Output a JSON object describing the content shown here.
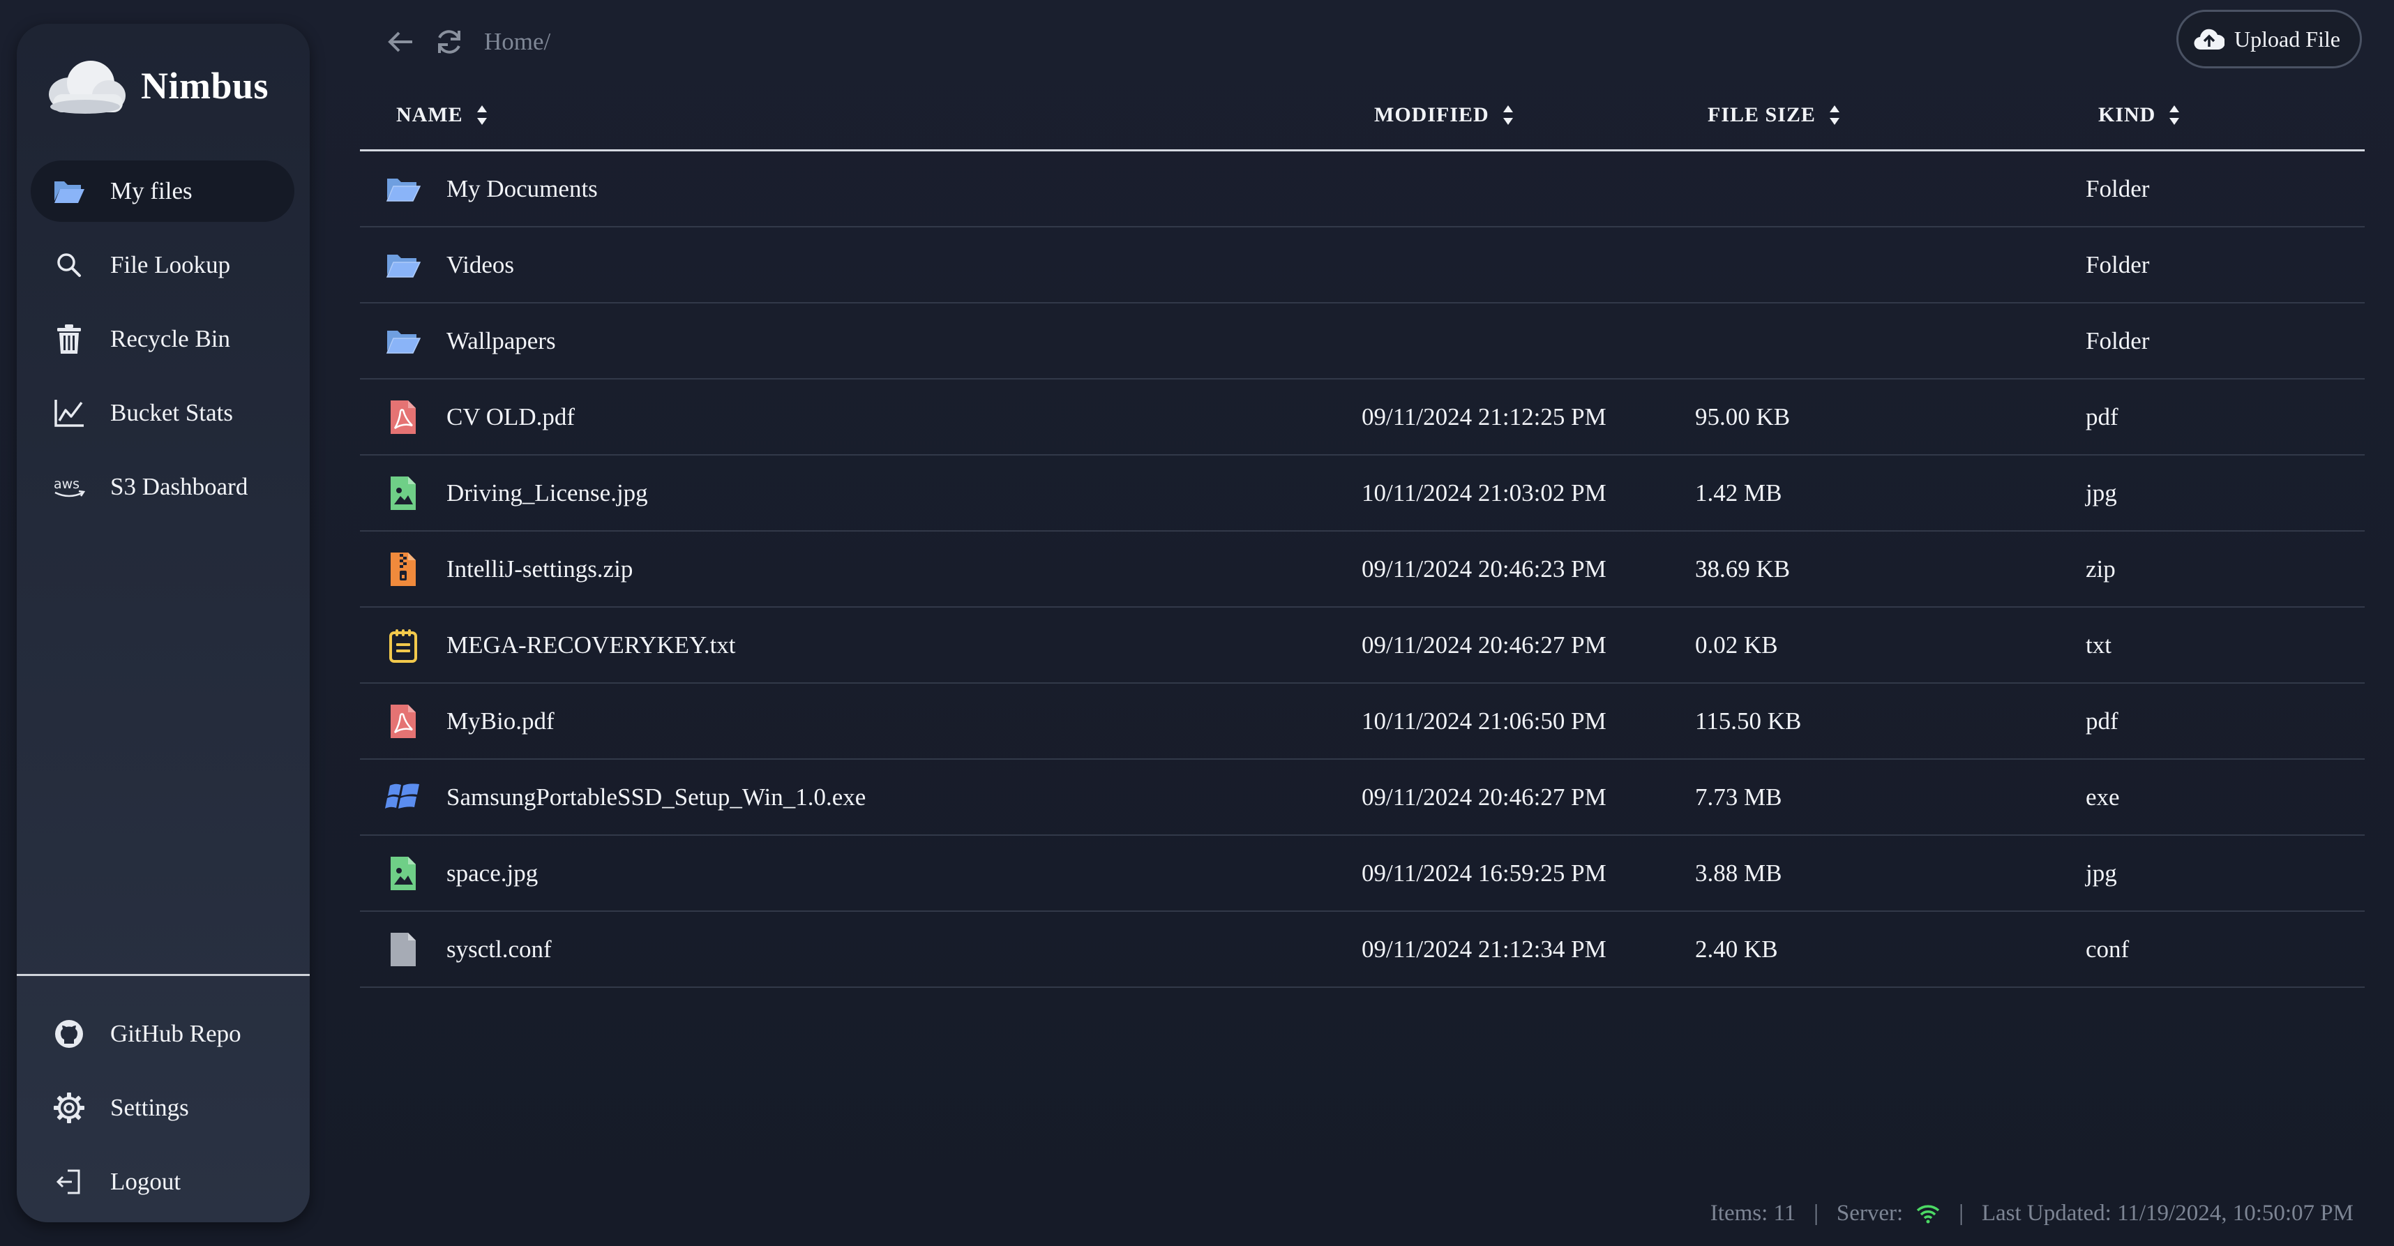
{
  "brand": {
    "name": "Nimbus"
  },
  "sidebar": {
    "items": [
      {
        "label": "My files",
        "icon": "folder-open-icon",
        "active": true
      },
      {
        "label": "File Lookup",
        "icon": "search-icon",
        "active": false
      },
      {
        "label": "Recycle Bin",
        "icon": "trash-icon",
        "active": false
      },
      {
        "label": "Bucket Stats",
        "icon": "chart-line-icon",
        "active": false
      },
      {
        "label": "S3 Dashboard",
        "icon": "aws-icon",
        "active": false
      }
    ],
    "bottom_items": [
      {
        "label": "GitHub Repo",
        "icon": "github-icon"
      },
      {
        "label": "Settings",
        "icon": "gear-icon"
      },
      {
        "label": "Logout",
        "icon": "logout-icon"
      }
    ]
  },
  "topbar": {
    "breadcrumb": "Home/",
    "upload_label": "Upload File"
  },
  "table": {
    "columns": [
      "NAME",
      "MODIFIED",
      "FILE SIZE",
      "KIND"
    ],
    "rows": [
      {
        "name": "My Documents",
        "modified": "",
        "size": "",
        "kind": "Folder",
        "icon": "folder-icon"
      },
      {
        "name": "Videos",
        "modified": "",
        "size": "",
        "kind": "Folder",
        "icon": "folder-icon"
      },
      {
        "name": "Wallpapers",
        "modified": "",
        "size": "",
        "kind": "Folder",
        "icon": "folder-icon"
      },
      {
        "name": "CV OLD.pdf",
        "modified": "09/11/2024 21:12:25 PM",
        "size": "95.00 KB",
        "kind": "pdf",
        "icon": "pdf-icon"
      },
      {
        "name": "Driving_License.jpg",
        "modified": "10/11/2024 21:03:02 PM",
        "size": "1.42 MB",
        "kind": "jpg",
        "icon": "image-icon"
      },
      {
        "name": "IntelliJ-settings.zip",
        "modified": "09/11/2024 20:46:23 PM",
        "size": "38.69 KB",
        "kind": "zip",
        "icon": "zip-icon"
      },
      {
        "name": "MEGA-RECOVERYKEY.txt",
        "modified": "09/11/2024 20:46:27 PM",
        "size": "0.02 KB",
        "kind": "txt",
        "icon": "text-file-icon"
      },
      {
        "name": "MyBio.pdf",
        "modified": "10/11/2024 21:06:50 PM",
        "size": "115.50 KB",
        "kind": "pdf",
        "icon": "pdf-icon"
      },
      {
        "name": "SamsungPortableSSD_Setup_Win_1.0.exe",
        "modified": "09/11/2024 20:46:27 PM",
        "size": "7.73 MB",
        "kind": "exe",
        "icon": "windows-icon"
      },
      {
        "name": "space.jpg",
        "modified": "09/11/2024 16:59:25 PM",
        "size": "3.88 MB",
        "kind": "jpg",
        "icon": "image-icon"
      },
      {
        "name": "sysctl.conf",
        "modified": "09/11/2024 21:12:34 PM",
        "size": "2.40 KB",
        "kind": "conf",
        "icon": "generic-file-icon"
      }
    ]
  },
  "footer": {
    "items": "Items: 11",
    "server": "Server:",
    "last_updated": "Last Updated: 11/19/2024, 10:50:07 PM"
  },
  "colors": {
    "background": "#1a1f2e",
    "sidebar": "#232a3a",
    "folder": "#8ab4f8",
    "pdf": "#e57373",
    "image": "#6fcf87",
    "zip": "#f08a3c",
    "txt": "#f2c94c",
    "windows": "#5b8def",
    "generic": "#a6abb5",
    "server_ok": "#4cd964"
  }
}
